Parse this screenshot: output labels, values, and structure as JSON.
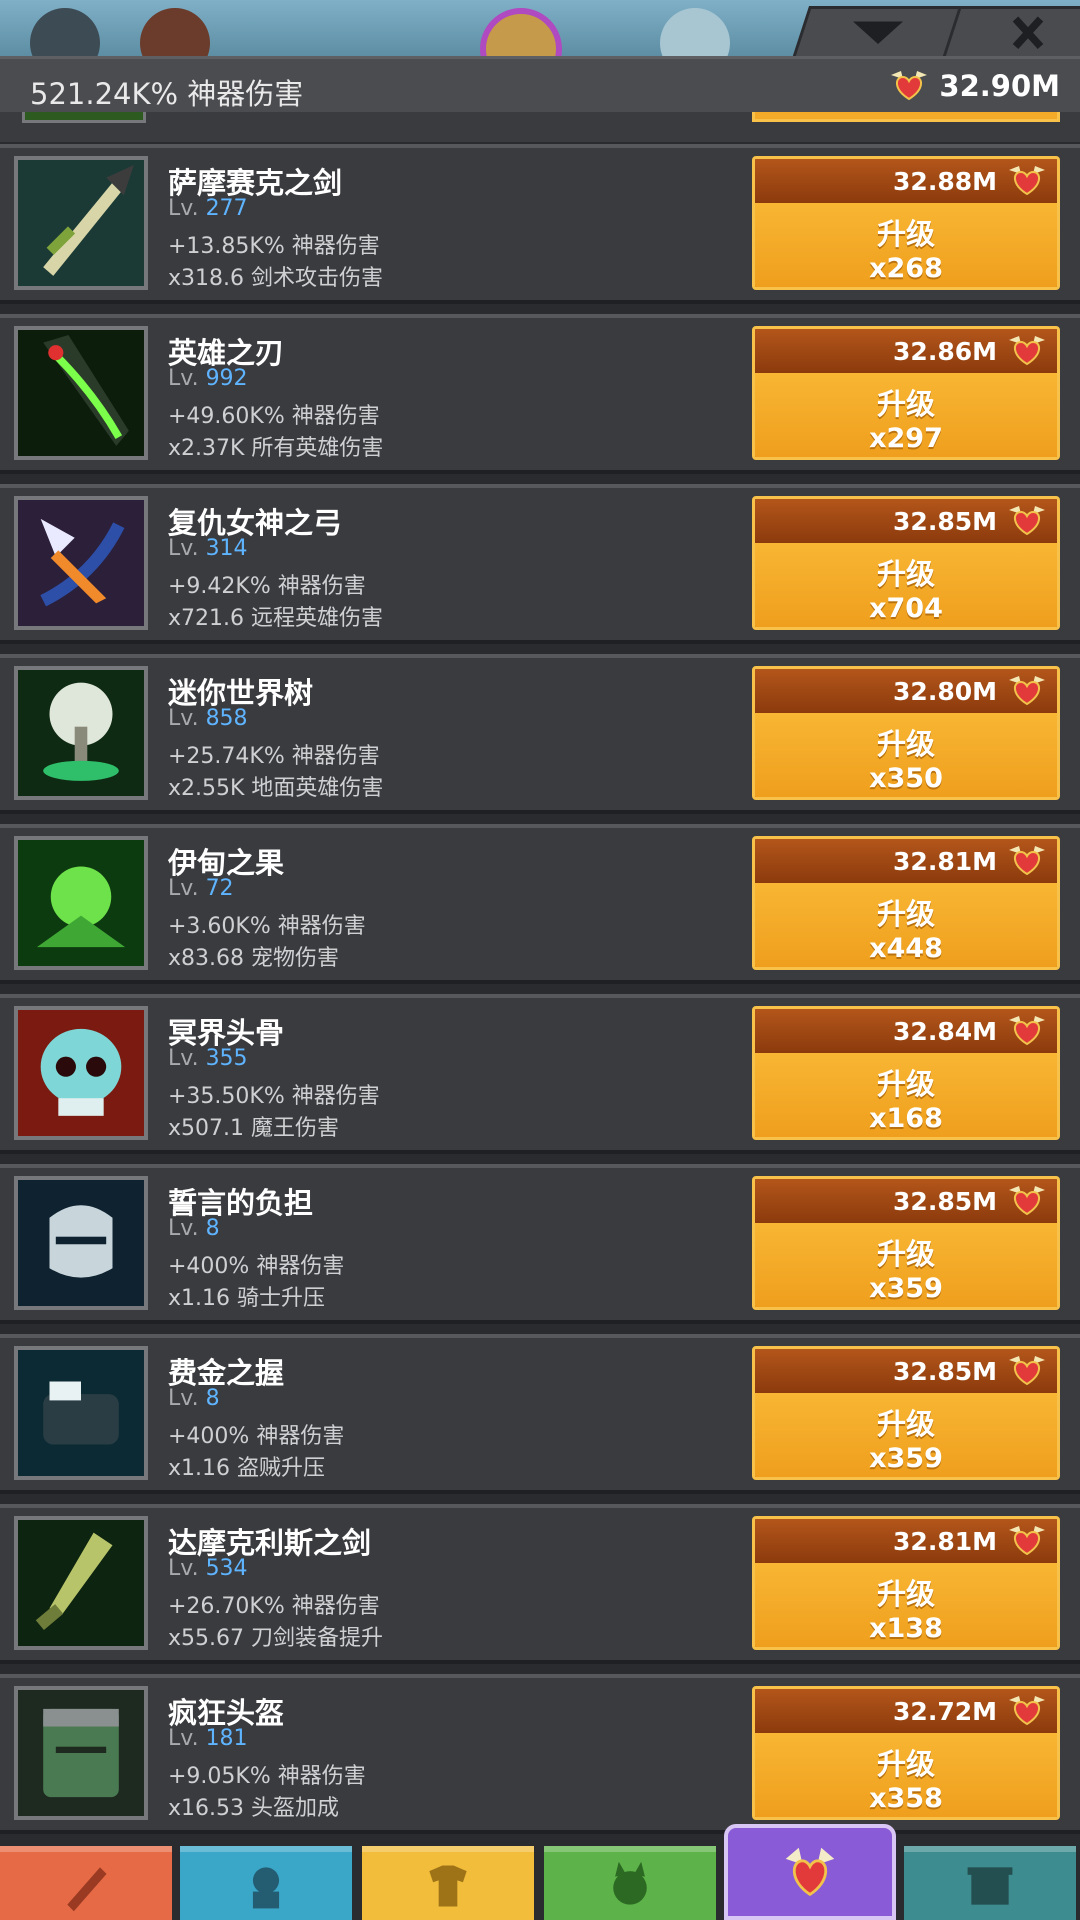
{
  "header": {
    "title": "521.24K% 神器伤害",
    "currency_value": "32.90M",
    "currency_icon": "winged-heart-icon"
  },
  "labels": {
    "upgrade": "升级",
    "lv_prefix": "Lv."
  },
  "artifacts": [
    {
      "name": "萨摩赛克之剑",
      "level": "277",
      "stat1": "+13.85K% 神器伤害",
      "stat2": "x318.6 剑术攻击伤害",
      "cost": "32.88M",
      "multiplier": "x268",
      "icon": "sword-icon"
    },
    {
      "name": "英雄之刃",
      "level": "992",
      "stat1": "+49.60K% 神器伤害",
      "stat2": "x2.37K 所有英雄伤害",
      "cost": "32.86M",
      "multiplier": "x297",
      "icon": "green-blade-icon"
    },
    {
      "name": "复仇女神之弓",
      "level": "314",
      "stat1": "+9.42K% 神器伤害",
      "stat2": "x721.6 远程英雄伤害",
      "cost": "32.85M",
      "multiplier": "x704",
      "icon": "bow-icon"
    },
    {
      "name": "迷你世界树",
      "level": "858",
      "stat1": "+25.74K% 神器伤害",
      "stat2": "x2.55K 地面英雄伤害",
      "cost": "32.80M",
      "multiplier": "x350",
      "icon": "tree-icon"
    },
    {
      "name": "伊甸之果",
      "level": "72",
      "stat1": "+3.60K% 神器伤害",
      "stat2": "x83.68 宠物伤害",
      "cost": "32.81M",
      "multiplier": "x448",
      "icon": "fruit-icon"
    },
    {
      "name": "冥界头骨",
      "level": "355",
      "stat1": "+35.50K% 神器伤害",
      "stat2": "x507.1 魔王伤害",
      "cost": "32.84M",
      "multiplier": "x168",
      "icon": "skull-icon"
    },
    {
      "name": "誓言的负担",
      "level": "8",
      "stat1": "+400% 神器伤害",
      "stat2": "x1.16 骑士升压",
      "cost": "32.85M",
      "multiplier": "x359",
      "icon": "helmet-icon"
    },
    {
      "name": "费金之握",
      "level": "8",
      "stat1": "+400% 神器伤害",
      "stat2": "x1.16 盗贼升压",
      "cost": "32.85M",
      "multiplier": "x359",
      "icon": "gauntlet-icon"
    },
    {
      "name": "达摩克利斯之剑",
      "level": "534",
      "stat1": "+26.70K% 神器伤害",
      "stat2": "x55.67 刀剑装备提升",
      "cost": "32.81M",
      "multiplier": "x138",
      "icon": "dagger-icon"
    },
    {
      "name": "疯狂头盔",
      "level": "181",
      "stat1": "+9.05K% 神器伤害",
      "stat2": "x16.53 头盔加成",
      "cost": "32.72M",
      "multiplier": "x358",
      "icon": "bucket-helm-icon"
    }
  ],
  "nav_tabs": [
    {
      "icon": "sword-tab-icon",
      "color": "#e66a45"
    },
    {
      "icon": "hero-tab-icon",
      "color": "#3aa6c8"
    },
    {
      "icon": "equipment-tab-icon",
      "color": "#f2bd3b"
    },
    {
      "icon": "pet-tab-icon",
      "color": "#5db34a"
    },
    {
      "icon": "artifact-tab-icon",
      "color": "#8a5bd6"
    },
    {
      "icon": "shop-tab-icon",
      "color": "#3d8c8f"
    }
  ]
}
